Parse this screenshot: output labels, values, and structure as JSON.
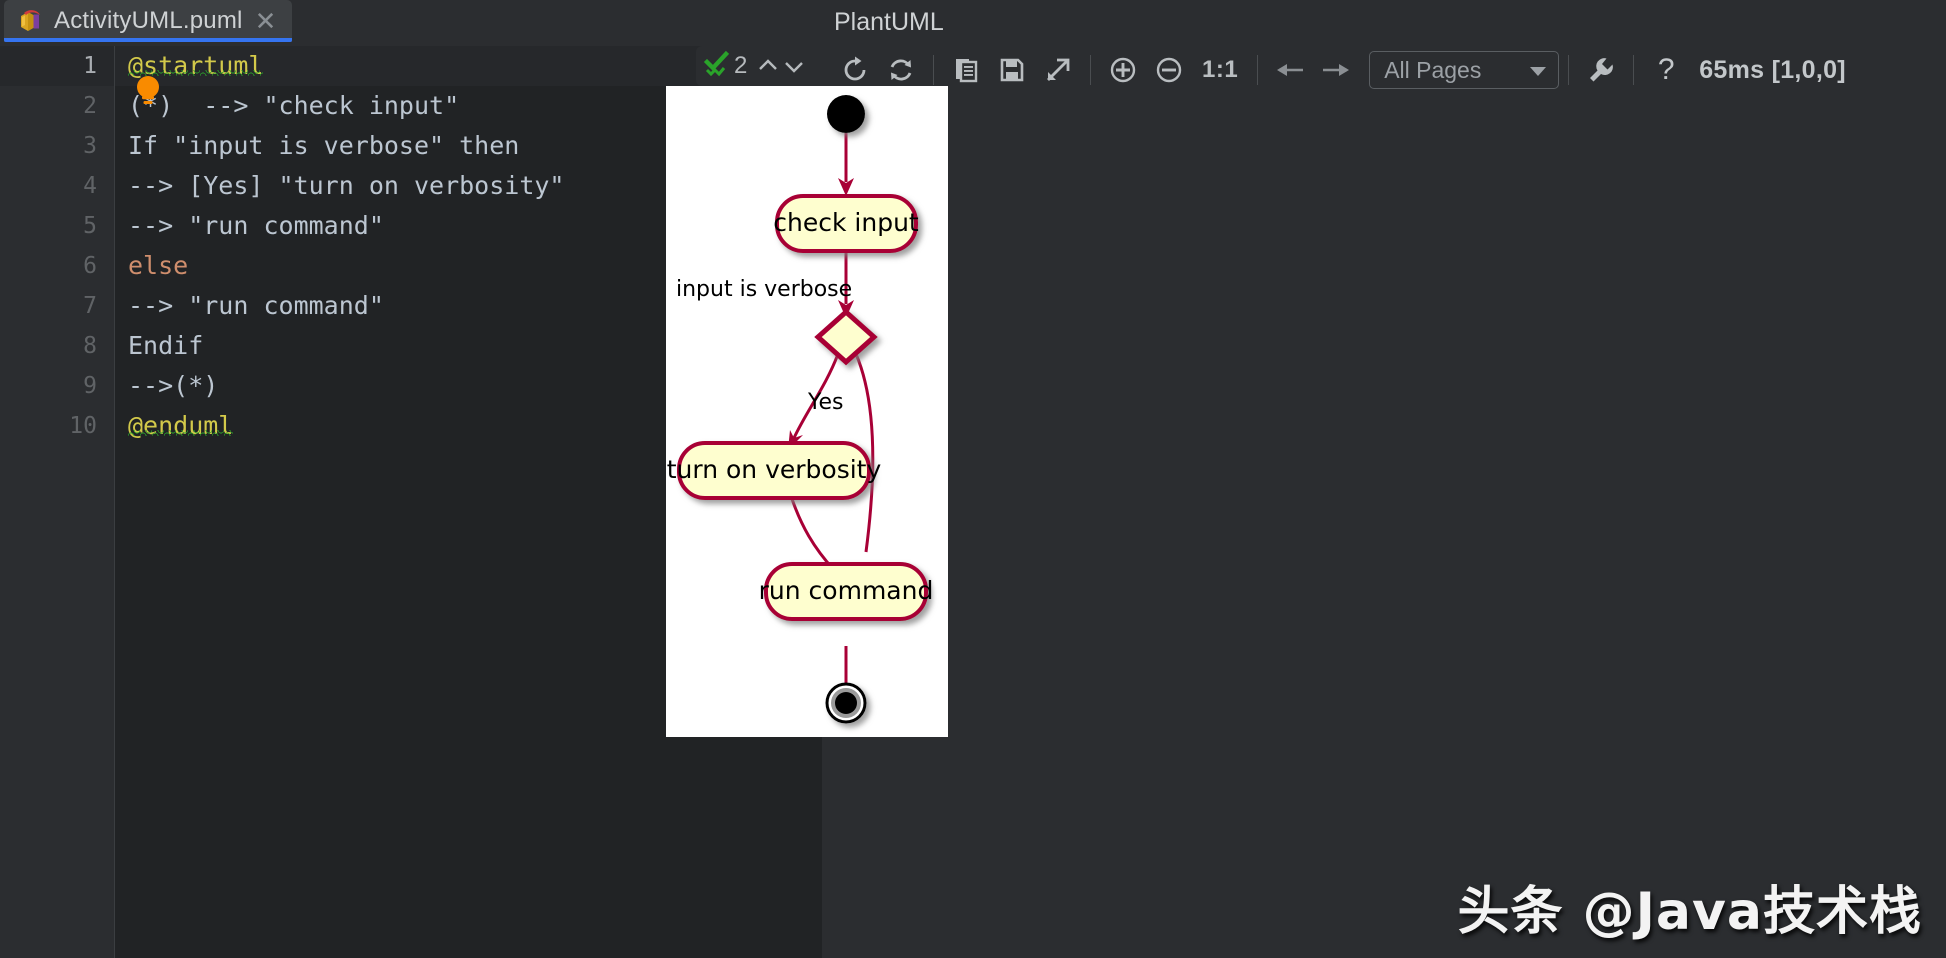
{
  "editor": {
    "tab": {
      "filename": "ActivityUML.puml",
      "icon": "plantuml-file-icon",
      "close_icon": "close-icon"
    },
    "inspection": {
      "icon": "inspections-ok-icon",
      "count": "2",
      "prev_icon": "chevron-up-icon",
      "next_icon": "chevron-down-icon"
    },
    "intention_bulb_icon": "lightbulb-icon",
    "lines": [
      {
        "num": "1",
        "text": "@startuml",
        "style": "yellow-squiggly"
      },
      {
        "num": "2",
        "text": "(*)  --> \"check input\"",
        "style": "plain"
      },
      {
        "num": "3",
        "text": "If \"input is verbose\" then",
        "style": "plain"
      },
      {
        "num": "4",
        "text": "--> [Yes] \"turn on verbosity\"",
        "style": "plain"
      },
      {
        "num": "5",
        "text": "--> \"run command\"",
        "style": "plain"
      },
      {
        "num": "6",
        "text": "else",
        "style": "orange"
      },
      {
        "num": "7",
        "text": "--> \"run command\"",
        "style": "plain"
      },
      {
        "num": "8",
        "text": "Endif",
        "style": "plain"
      },
      {
        "num": "9",
        "text": "-->(*)",
        "style": "plain"
      },
      {
        "num": "10",
        "text": "@enduml",
        "style": "yellow-squiggly"
      }
    ]
  },
  "preview": {
    "title": "PlantUML",
    "toolbar": {
      "refresh_icon": "refresh-icon",
      "autorefresh_icon": "auto-refresh-icon",
      "copy_icon": "copy-icon",
      "save_icon": "save-icon",
      "open_external_icon": "open-external-icon",
      "zoom_in_icon": "zoom-in-icon",
      "zoom_out_icon": "zoom-out-icon",
      "actual_size_label": "1:1",
      "prev_icon": "arrow-left-icon",
      "next_icon": "arrow-right-icon",
      "pages_value": "All Pages",
      "pages_chevron_icon": "chevron-down-icon",
      "settings_icon": "wrench-icon",
      "help_icon": "question-mark-icon"
    },
    "status": "65ms [1,0,0]"
  },
  "diagram": {
    "type": "activity-diagram",
    "start_node": "start-node",
    "end_node": "end-node",
    "decision_node": "decision-diamond",
    "nodes": [
      {
        "id": "check-input",
        "label": "check input"
      },
      {
        "id": "turn-on-verbosity",
        "label": "turn on verbosity"
      },
      {
        "id": "run-command",
        "label": "run command"
      }
    ],
    "edge_labels": [
      {
        "id": "condition-label",
        "text": "input is verbose"
      },
      {
        "id": "yes-label",
        "text": "Yes"
      }
    ],
    "colors": {
      "node_fill": "#fefecf",
      "node_border": "#a80036",
      "arrow": "#a80036",
      "canvas": "#ffffff"
    }
  },
  "watermark": "头条 @Java技术栈"
}
